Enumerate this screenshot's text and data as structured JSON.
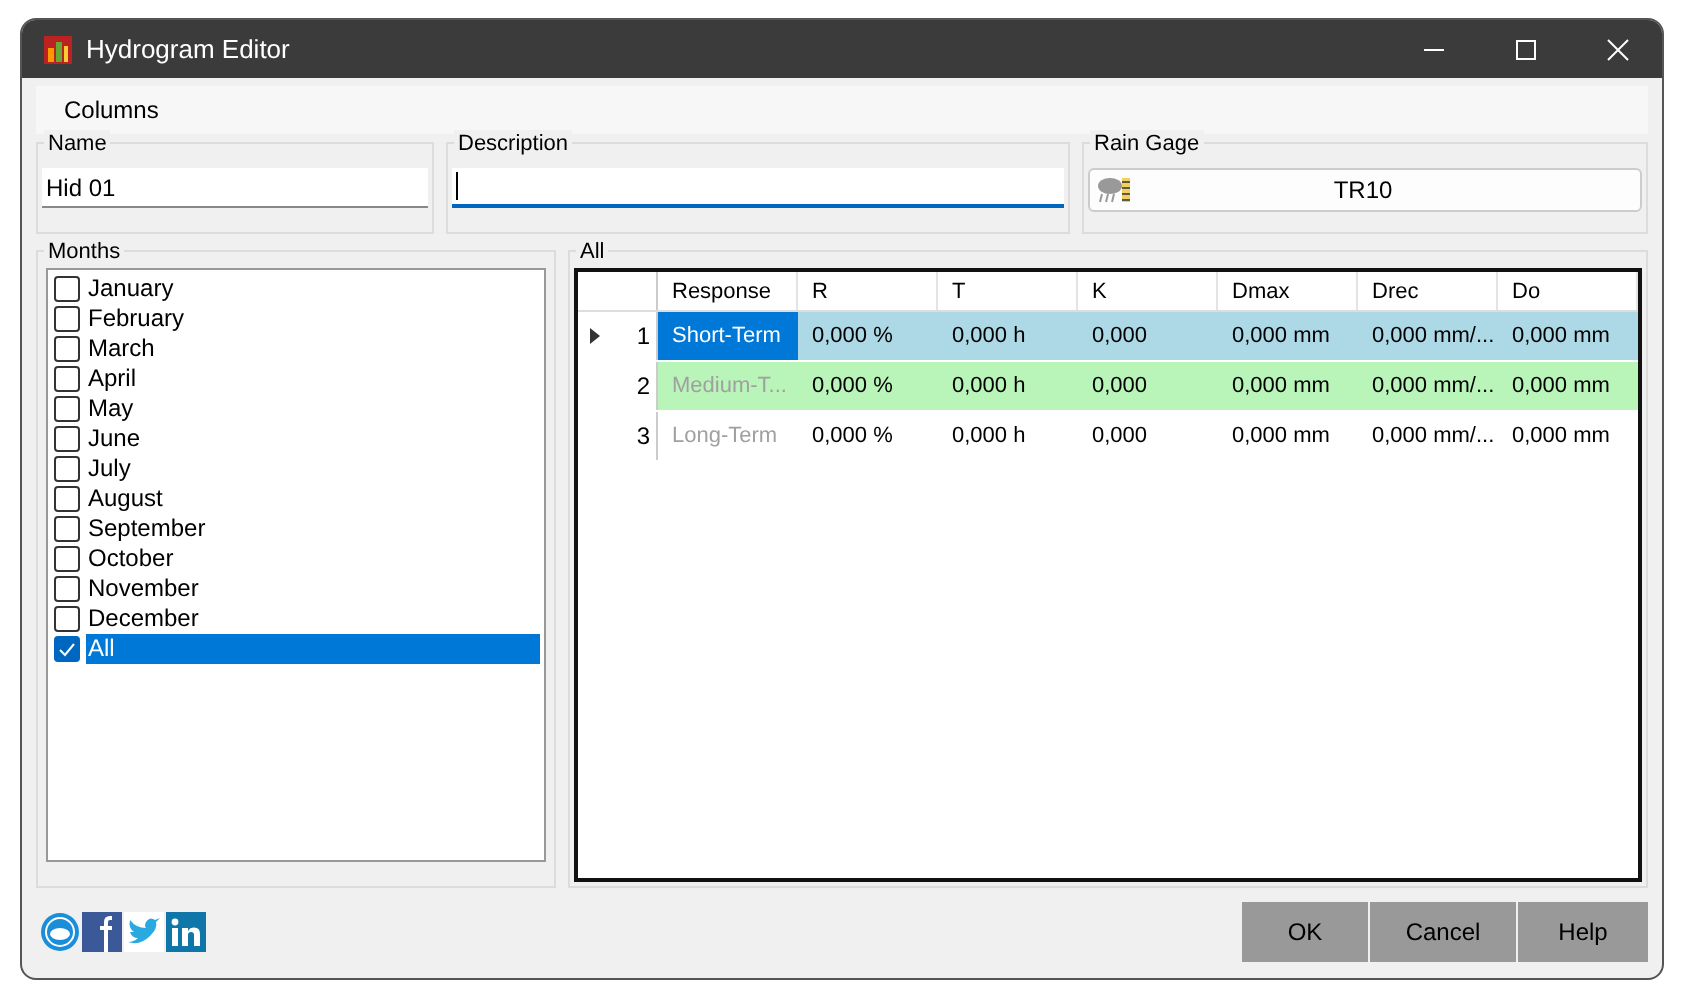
{
  "window": {
    "title": "Hydrogram Editor"
  },
  "menu": [
    "Columns"
  ],
  "name_field": {
    "label": "Name",
    "value": "Hid 01"
  },
  "description_field": {
    "label": "Description"
  },
  "rain_gage": {
    "label": "Rain Gage",
    "value": "TR10"
  },
  "months": {
    "label": "Months",
    "items": [
      {
        "label": "January",
        "checked": false,
        "selected": false
      },
      {
        "label": "February",
        "checked": false,
        "selected": false
      },
      {
        "label": "March",
        "checked": false,
        "selected": false
      },
      {
        "label": "April",
        "checked": false,
        "selected": false
      },
      {
        "label": "May",
        "checked": false,
        "selected": false
      },
      {
        "label": "June",
        "checked": false,
        "selected": false
      },
      {
        "label": "July",
        "checked": false,
        "selected": false
      },
      {
        "label": "August",
        "checked": false,
        "selected": false
      },
      {
        "label": "September",
        "checked": false,
        "selected": false
      },
      {
        "label": "October",
        "checked": false,
        "selected": false
      },
      {
        "label": "November",
        "checked": false,
        "selected": false
      },
      {
        "label": "December",
        "checked": false,
        "selected": false
      },
      {
        "label": "All",
        "checked": true,
        "selected": true
      }
    ]
  },
  "table": {
    "label": "All",
    "columns": [
      "Response",
      "R",
      "T",
      "K",
      "Dmax",
      "Drec",
      "Do"
    ],
    "rows": [
      {
        "number": "1",
        "selected": true,
        "color": "#add8e6",
        "response_disabled": false,
        "cells": [
          "Short-Term",
          "0,000 %",
          "0,000 h",
          "0,000",
          "0,000 mm",
          "0,000 mm/...",
          "0,000 mm"
        ]
      },
      {
        "number": "2",
        "selected": false,
        "color": "#b9f5b9",
        "response_disabled": true,
        "cells": [
          "Medium-T...",
          "0,000 %",
          "0,000 h",
          "0,000",
          "0,000 mm",
          "0,000 mm/...",
          "0,000 mm"
        ]
      },
      {
        "number": "3",
        "selected": false,
        "color": "#ffffff",
        "response_disabled": true,
        "cells": [
          "Long-Term",
          "0,000 %",
          "0,000 h",
          "0,000",
          "0,000 mm",
          "0,000 mm/...",
          "0,000 mm"
        ]
      }
    ]
  },
  "buttons": [
    "OK",
    "Cancel",
    "Help"
  ]
}
